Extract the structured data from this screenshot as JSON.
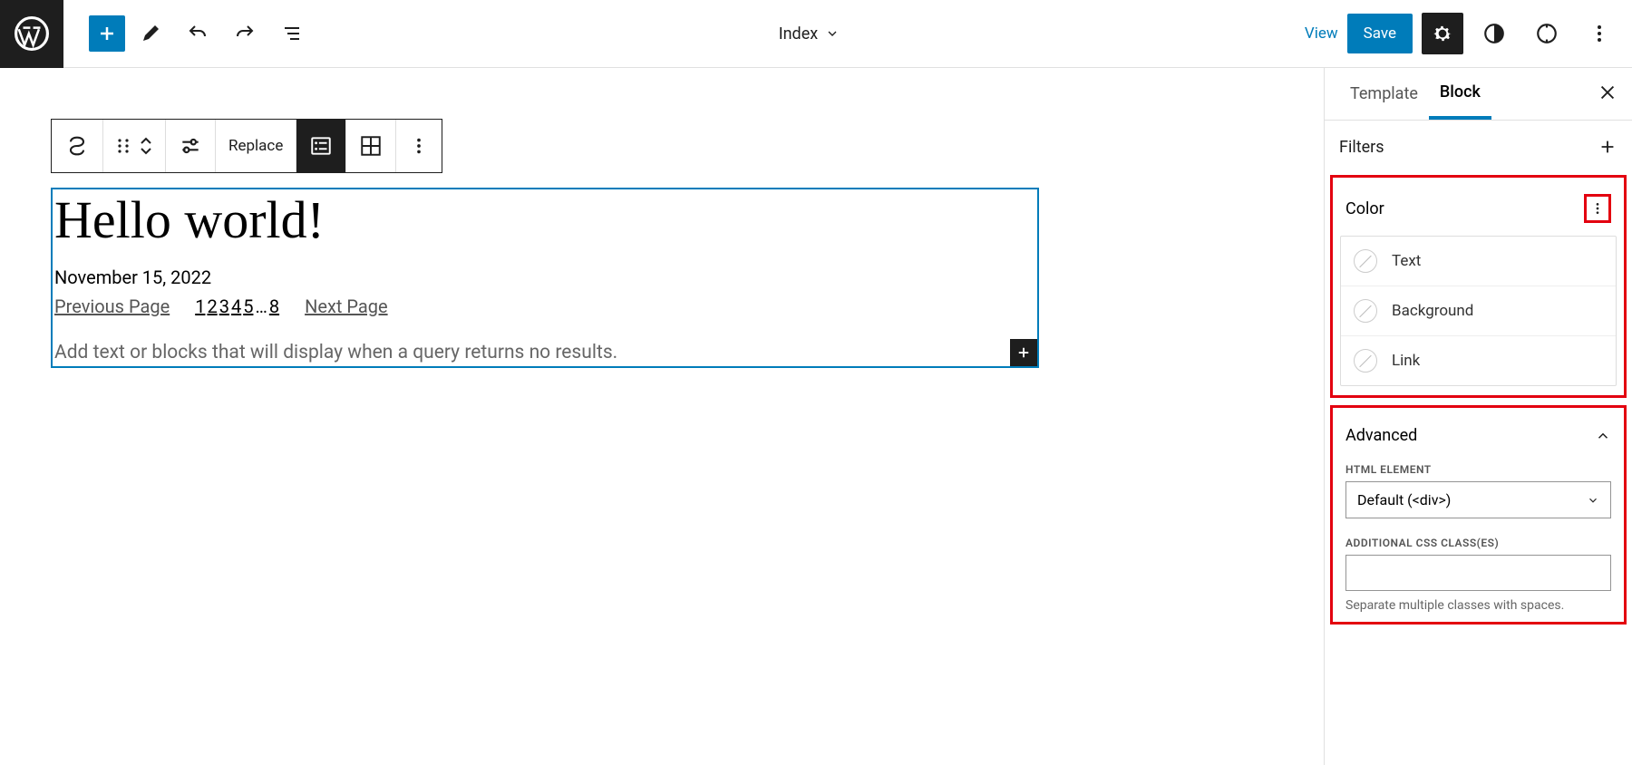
{
  "header": {
    "center_label": "Index",
    "view": "View",
    "save": "Save"
  },
  "block_toolbar": {
    "replace": "Replace"
  },
  "content": {
    "title": "Hello world!",
    "date": "November 15, 2022",
    "prev": "Previous Page",
    "next": "Next Page",
    "pages": [
      "1",
      "2",
      "3",
      "4",
      "5",
      "…",
      "8"
    ],
    "placeholder": "Add text or blocks that will display when a query returns no results."
  },
  "sidebar": {
    "tab_template": "Template",
    "tab_block": "Block",
    "filters": "Filters",
    "color": {
      "title": "Color",
      "text": "Text",
      "background": "Background",
      "link": "Link"
    },
    "advanced": {
      "title": "Advanced",
      "html_label": "HTML ELEMENT",
      "html_value": "Default (<div>)",
      "css_label": "ADDITIONAL CSS CLASS(ES)",
      "css_help": "Separate multiple classes with spaces."
    }
  }
}
